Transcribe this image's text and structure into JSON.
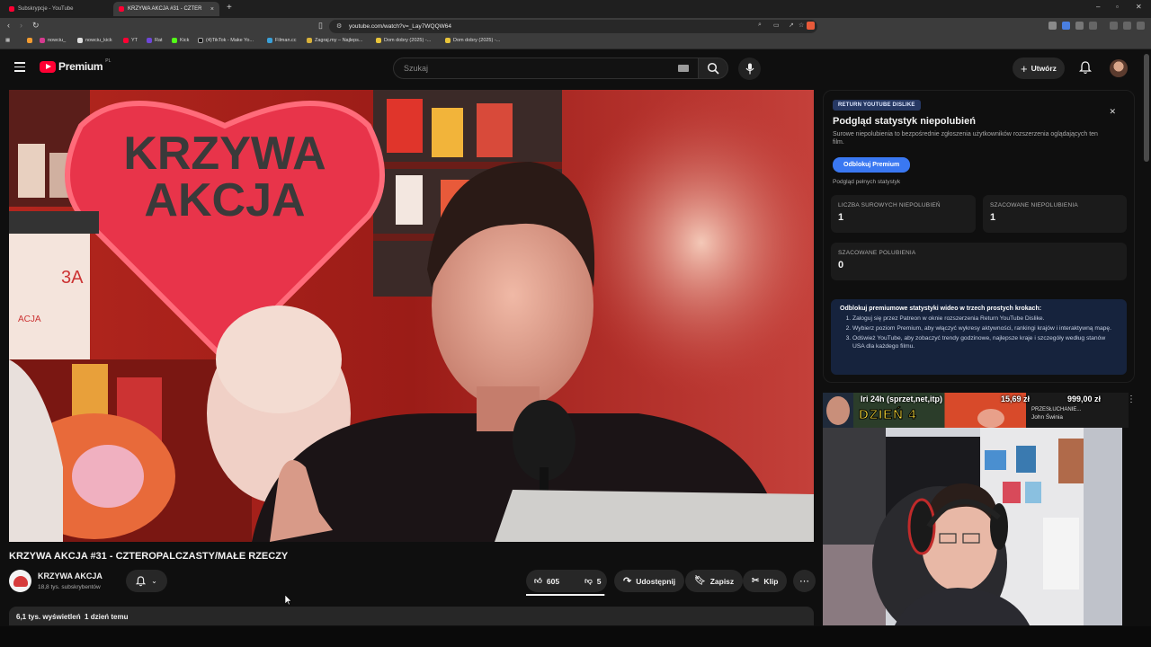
{
  "browser": {
    "tabs": [
      {
        "title": "Subskrypcje - YouTube",
        "active": false
      },
      {
        "title": "KRZYWA AKCJA #31 - CZTER",
        "active": true
      }
    ],
    "url": "youtube.com/watch?v=_Lay7WQQW64",
    "bookmarks": [
      "nowciu_",
      "nowciu_kick",
      "YT",
      "Rat",
      "Kick",
      "(4)TikTok - Make Yo...",
      "Filman.cc",
      "Zagraj.my – Najleps...",
      "Dom dobry (2025) -...",
      "Dom dobry (2025) -..."
    ]
  },
  "masthead": {
    "logo_text": "Premium",
    "logo_region": "PL",
    "search_placeholder": "Szukaj",
    "create_label": "Utwórz"
  },
  "player": {
    "sign_line1": "KRZYWA",
    "sign_line2": "AKCJA",
    "board_text1": "3A",
    "board_text2": "ACJA"
  },
  "video": {
    "title": "KRZYWA AKCJA #31 - CZTEROPALCZASTY/MAŁE RZECZY",
    "channel": "KRZYWA AKCJA",
    "subscribers": "18,8 tys. subskrybentów",
    "likes": "605",
    "dislikes": "5",
    "like_ratio": 0.99,
    "share_label": "Udostępnij",
    "save_label": "Zapisz",
    "clip_label": "Klip",
    "views": "6,1 tys. wyświetleń",
    "date": "1 dzień temu"
  },
  "ryd": {
    "badge": "RETURN YOUTUBE DISLIKE",
    "title": "Podgląd statystyk niepolubień",
    "subtitle": "Surowe niepolubienia to bezpośrednie zgłoszenia użytkowników rozszerzenia oglądających ten film.",
    "button": "Odblokuj Premium",
    "full_stats": "Podgląd pełnych statystyk",
    "cards": [
      {
        "label": "LICZBA SUROWYCH NIEPOLUBIEŃ",
        "value": "1"
      },
      {
        "label": "SZACOWANE NIEPOLUBIENIA",
        "value": "1"
      },
      {
        "label": "SZACOWANE POLUBIENIA",
        "value": "0"
      }
    ],
    "info_head": "Odblokuj premiumowe statystyki wideo w trzech prostych krokach:",
    "steps": [
      "Zaloguj się przez Patreon w oknie rozszerzenia Return YouTube Dislike.",
      "Wybierz poziom Premium, aby włączyć wykresy aktywności, rankingi krajów i interaktywną mapę.",
      "Odśwież YouTube, aby zobaczyć trendy godzinowe, najlepsze kraje i szczegóły według stanów USA dla każdego filmu."
    ]
  },
  "overlay": {
    "text1": "Iri 24h (sprzet,net,itp)",
    "price1": "15,69 zł",
    "price2": "999,00 zł",
    "thumb_text": "DZIEŃ 4",
    "sub_title": "PRZESŁUCHANIE...",
    "sub_channel": "John Świnia"
  },
  "colors": {
    "accent": "#3a78f2",
    "youtube_red": "#ff0033",
    "ryd_info_bg": "#16233d"
  }
}
